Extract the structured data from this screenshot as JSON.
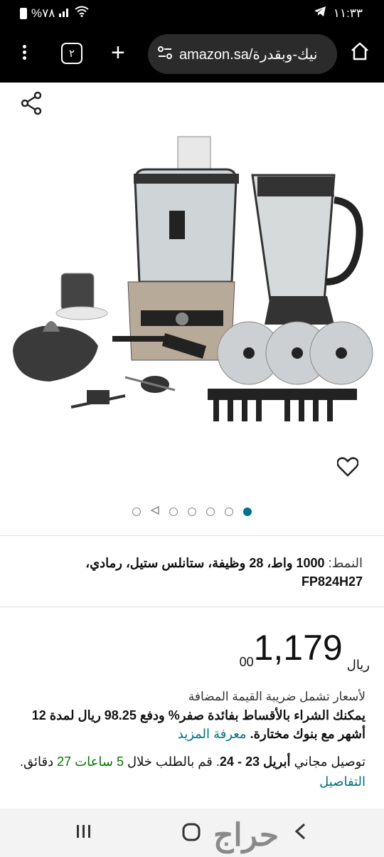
{
  "status": {
    "battery": "%٧٨",
    "time": "١١:٣٣"
  },
  "browser": {
    "tab_count": "٢",
    "url": "amazon.sa/نيك-وبقدرة"
  },
  "product": {
    "style_label": "النمط:",
    "style_value": "1000 واط، 28 وظيفة، ستانلس ستيل، رمادي، FP824H27",
    "price_whole": "1,179",
    "price_fraction": "00",
    "currency": "ريال",
    "vat_note": "لأسعار تشمل ضريبة القيمة المضافة",
    "installment_text": "يمكنك الشراء بالأقساط بفائدة صفر% ودفع 98.25 ريال لمدة 12 أشهر مع بنوك مختارة.",
    "learn_more": "معرفة المزيد",
    "delivery_prefix": "توصيل مجاني",
    "delivery_dates": "أبريل 23 - 24",
    "delivery_order": ". قم بالطلب خلال",
    "delivery_time": "5 ساعات 27",
    "delivery_minutes": "دقائق.",
    "details_link": "التفاصيل",
    "image_count": 7,
    "active_image": 1
  },
  "colors": {
    "link": "#007185",
    "delivery_green": "#007600",
    "pager_active": "#00718f"
  },
  "watermark": "حراج"
}
